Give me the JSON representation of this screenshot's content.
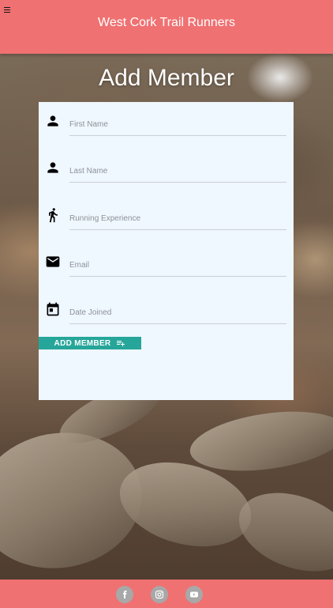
{
  "header": {
    "title": "West Cork Trail Runners",
    "menu_icon": "hamburger-menu-icon"
  },
  "page": {
    "title": "Add Member"
  },
  "form": {
    "fields": [
      {
        "icon": "person-icon",
        "placeholder": "First Name",
        "value": ""
      },
      {
        "icon": "person-icon",
        "placeholder": "Last Name",
        "value": ""
      },
      {
        "icon": "running-icon",
        "placeholder": "Running Experience",
        "value": ""
      },
      {
        "icon": "email-icon",
        "placeholder": "Email",
        "value": ""
      },
      {
        "icon": "calendar-icon",
        "placeholder": "Date Joined",
        "value": ""
      }
    ],
    "submit_label": "ADD MEMBER",
    "submit_icon": "playlist-add-icon"
  },
  "footer": {
    "social_icons": [
      "facebook-icon",
      "instagram-icon",
      "youtube-icon"
    ]
  },
  "colors": {
    "header_bg": "#f07172",
    "footer_bg": "#f07172",
    "button_bg": "#26a69a",
    "card_bg": "#eff7ff",
    "social_icon_bg": "#a8a8a8"
  }
}
